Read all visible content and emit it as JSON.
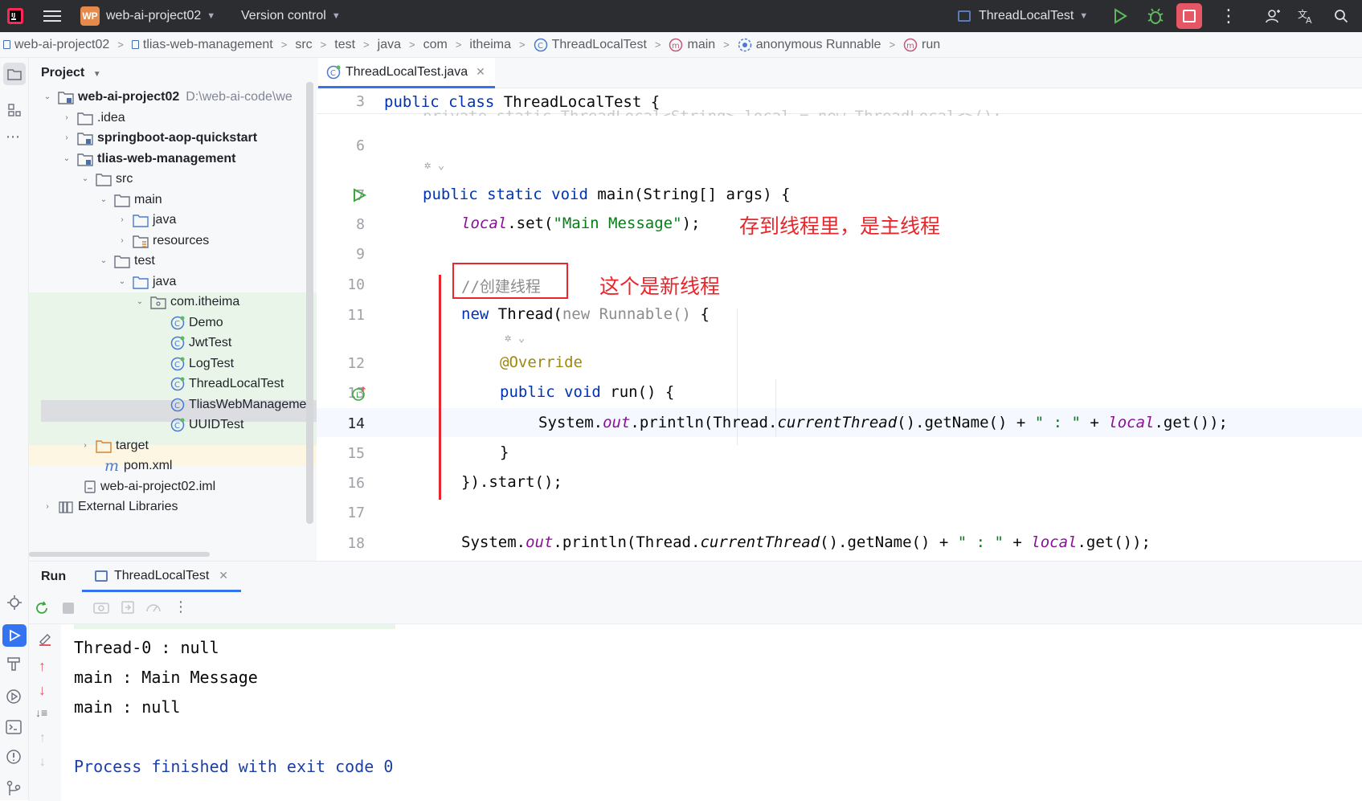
{
  "titlebar": {
    "project_badge": "WP",
    "project_name": "web-ai-project02",
    "vcs": "Version control",
    "run_config": "ThreadLocalTest"
  },
  "breadcrumb": [
    "web-ai-project02",
    "tlias-web-management",
    "src",
    "test",
    "java",
    "com",
    "itheima",
    "ThreadLocalTest",
    "main",
    "anonymous Runnable",
    "run"
  ],
  "project": {
    "title": "Project",
    "tree": [
      {
        "label": "web-ai-project02",
        "path": "D:\\web-ai-code\\we"
      },
      {
        "label": ".idea"
      },
      {
        "label": "springboot-aop-quickstart"
      },
      {
        "label": "tlias-web-management"
      },
      {
        "label": "src"
      },
      {
        "label": "main"
      },
      {
        "label": "java"
      },
      {
        "label": "resources"
      },
      {
        "label": "test"
      },
      {
        "label": "java"
      },
      {
        "label": "com.itheima"
      },
      {
        "label": "Demo"
      },
      {
        "label": "JwtTest"
      },
      {
        "label": "LogTest"
      },
      {
        "label": "ThreadLocalTest"
      },
      {
        "label": "TliasWebManageme"
      },
      {
        "label": "UUIDTest"
      },
      {
        "label": "target"
      },
      {
        "label": "pom.xml"
      },
      {
        "label": "web-ai-project02.iml"
      },
      {
        "label": "External Libraries"
      }
    ]
  },
  "editor": {
    "tab": "ThreadLocalTest.java",
    "line_numbers": [
      "3",
      "6",
      "7",
      "8",
      "9",
      "10",
      "11",
      "12",
      "13",
      "14",
      "15",
      "16",
      "17",
      "18"
    ],
    "code": {
      "l3_kw": "public class",
      "l3_rest": " ThreadLocalTest {",
      "l7_kw": "public static void",
      "l7_rest": " main(String[] args) {",
      "l8_fld": "local",
      "l8_mid": ".set(",
      "l8_str": "\"Main Message\"",
      "l8_end": ");",
      "l10_comment": "//创建线程",
      "l11_kw": "new",
      "l11_mid": " Thread(",
      "l11_gray": "new Runnable()",
      "l11_end": " {",
      "l12_ann": "@Override",
      "l13_kw": "public void",
      "l13_rest": " run() {",
      "l14_a": "System.",
      "l14_out": "out",
      "l14_b": ".println(Thread.",
      "l14_ct": "currentThread",
      "l14_c": "().getName() + ",
      "l14_str": "\" : \"",
      "l14_d": " + ",
      "l14_fld": "local",
      "l14_e": ".get());",
      "l15": "}",
      "l16": "}).start();",
      "l18_a": "System.",
      "l18_out": "out",
      "l18_b": ".println(Thread.",
      "l18_ct": "currentThread",
      "l18_c": "().getName() + ",
      "l18_str": "\" : \"",
      "l18_d": " + ",
      "l18_fld": "local",
      "l18_e": ".get());"
    },
    "notes": {
      "main_thread": "存到线程里，是主线程",
      "new_thread": "这个是新线程"
    }
  },
  "run": {
    "title": "Run",
    "tab": "ThreadLocalTest",
    "output": [
      "Thread-0 : null",
      "main : Main Message",
      "main : null",
      "Process finished with exit code 0"
    ]
  },
  "colors": {
    "accent": "#3574f0",
    "annotation_red": "#e8262b",
    "stop_button": "#e55765",
    "run_green": "#3ca63c",
    "test_highlight": "#eaf5e9",
    "excluded_highlight": "#fdf6e3"
  }
}
